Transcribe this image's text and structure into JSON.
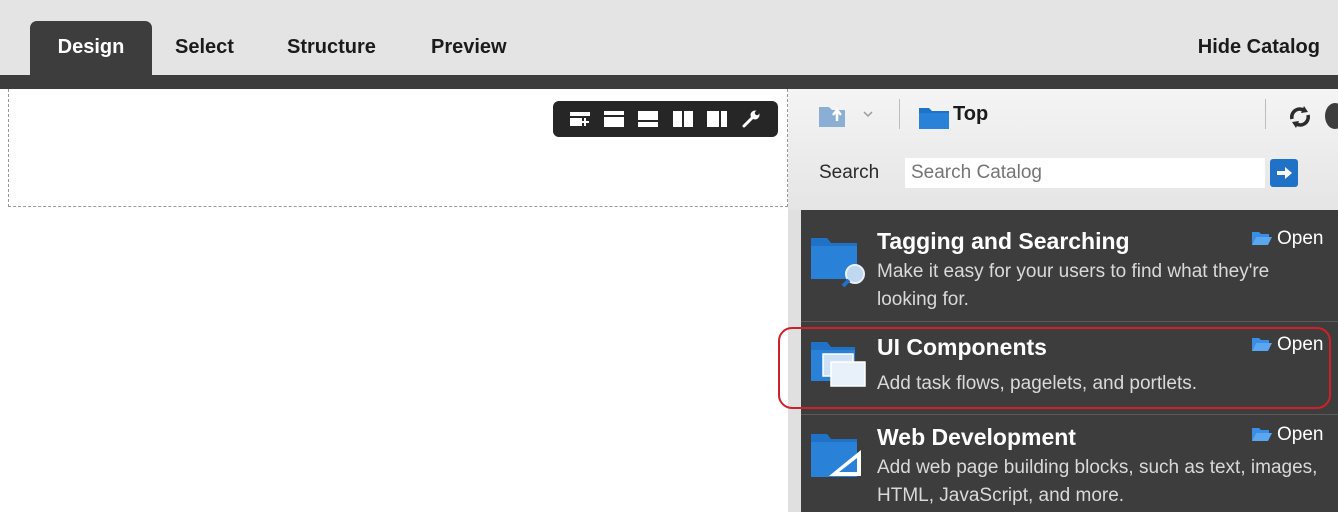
{
  "tabs": [
    {
      "label": "Design",
      "active": true
    },
    {
      "label": "Select",
      "active": false
    },
    {
      "label": "Structure",
      "active": false
    },
    {
      "label": "Preview",
      "active": false
    }
  ],
  "hide_catalog_label": "Hide Catalog",
  "layout_toolbar": {
    "icons": [
      "add-box-icon",
      "one-column-icon",
      "two-row-icon",
      "two-column-icon",
      "three-column-icon",
      "wrench-icon"
    ]
  },
  "catalog": {
    "location_label": "Top",
    "search": {
      "label": "Search",
      "placeholder": "Search Catalog"
    },
    "items": [
      {
        "title": "Tagging and Searching",
        "description": "Make it easy for your users to find what they're looking for.",
        "open_label": "Open",
        "icon": "tagging-folder-icon"
      },
      {
        "title": "UI Components",
        "description": "Add task flows, pagelets, and portlets.",
        "open_label": "Open",
        "icon": "ui-components-folder-icon",
        "highlighted": true
      },
      {
        "title": "Web Development",
        "description": "Add web page building blocks, such as text, images, HTML, JavaScript, and more.",
        "open_label": "Open",
        "icon": "web-development-folder-icon"
      }
    ]
  },
  "colors": {
    "accent_blue": "#1f72c6",
    "dark_panel": "#3d3d3d",
    "highlight_red": "#d0202a"
  }
}
